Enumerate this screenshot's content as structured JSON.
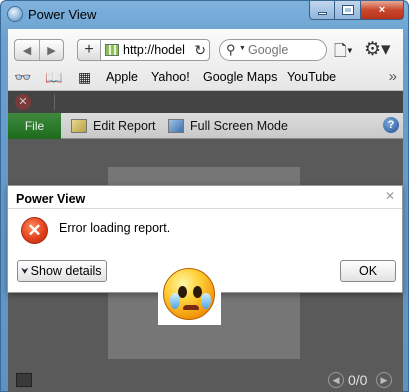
{
  "window": {
    "title": "Power View",
    "buttons": {
      "minimize": "minimize",
      "maximize": "maximize",
      "close": "×"
    }
  },
  "navbar": {
    "back_icon": "back-arrow-icon",
    "forward_icon": "forward-arrow-icon",
    "new_tab_glyph": "+",
    "url": "http://hodel",
    "reload_glyph": "↻",
    "search": {
      "placeholder": "Google",
      "value": ""
    }
  },
  "bookmarks": {
    "items": [
      "Apple",
      "Yahoo!",
      "Google Maps",
      "YouTube"
    ],
    "more_glyph": "»"
  },
  "app": {
    "ribbon": {
      "file_tab": "File",
      "edit_report": "Edit Report",
      "full_screen": "Full Screen Mode",
      "help_glyph": "?"
    },
    "pagination": "0/0"
  },
  "dialog": {
    "title": "Power View",
    "close_glyph": "✕",
    "error_glyph": "✕",
    "message": "Error loading report.",
    "show_details": "Show details",
    "ok": "OK"
  },
  "colors": {
    "file_tab": "#2a7a2a",
    "error": "#e2421d",
    "canvas": "#5a5a5a"
  }
}
